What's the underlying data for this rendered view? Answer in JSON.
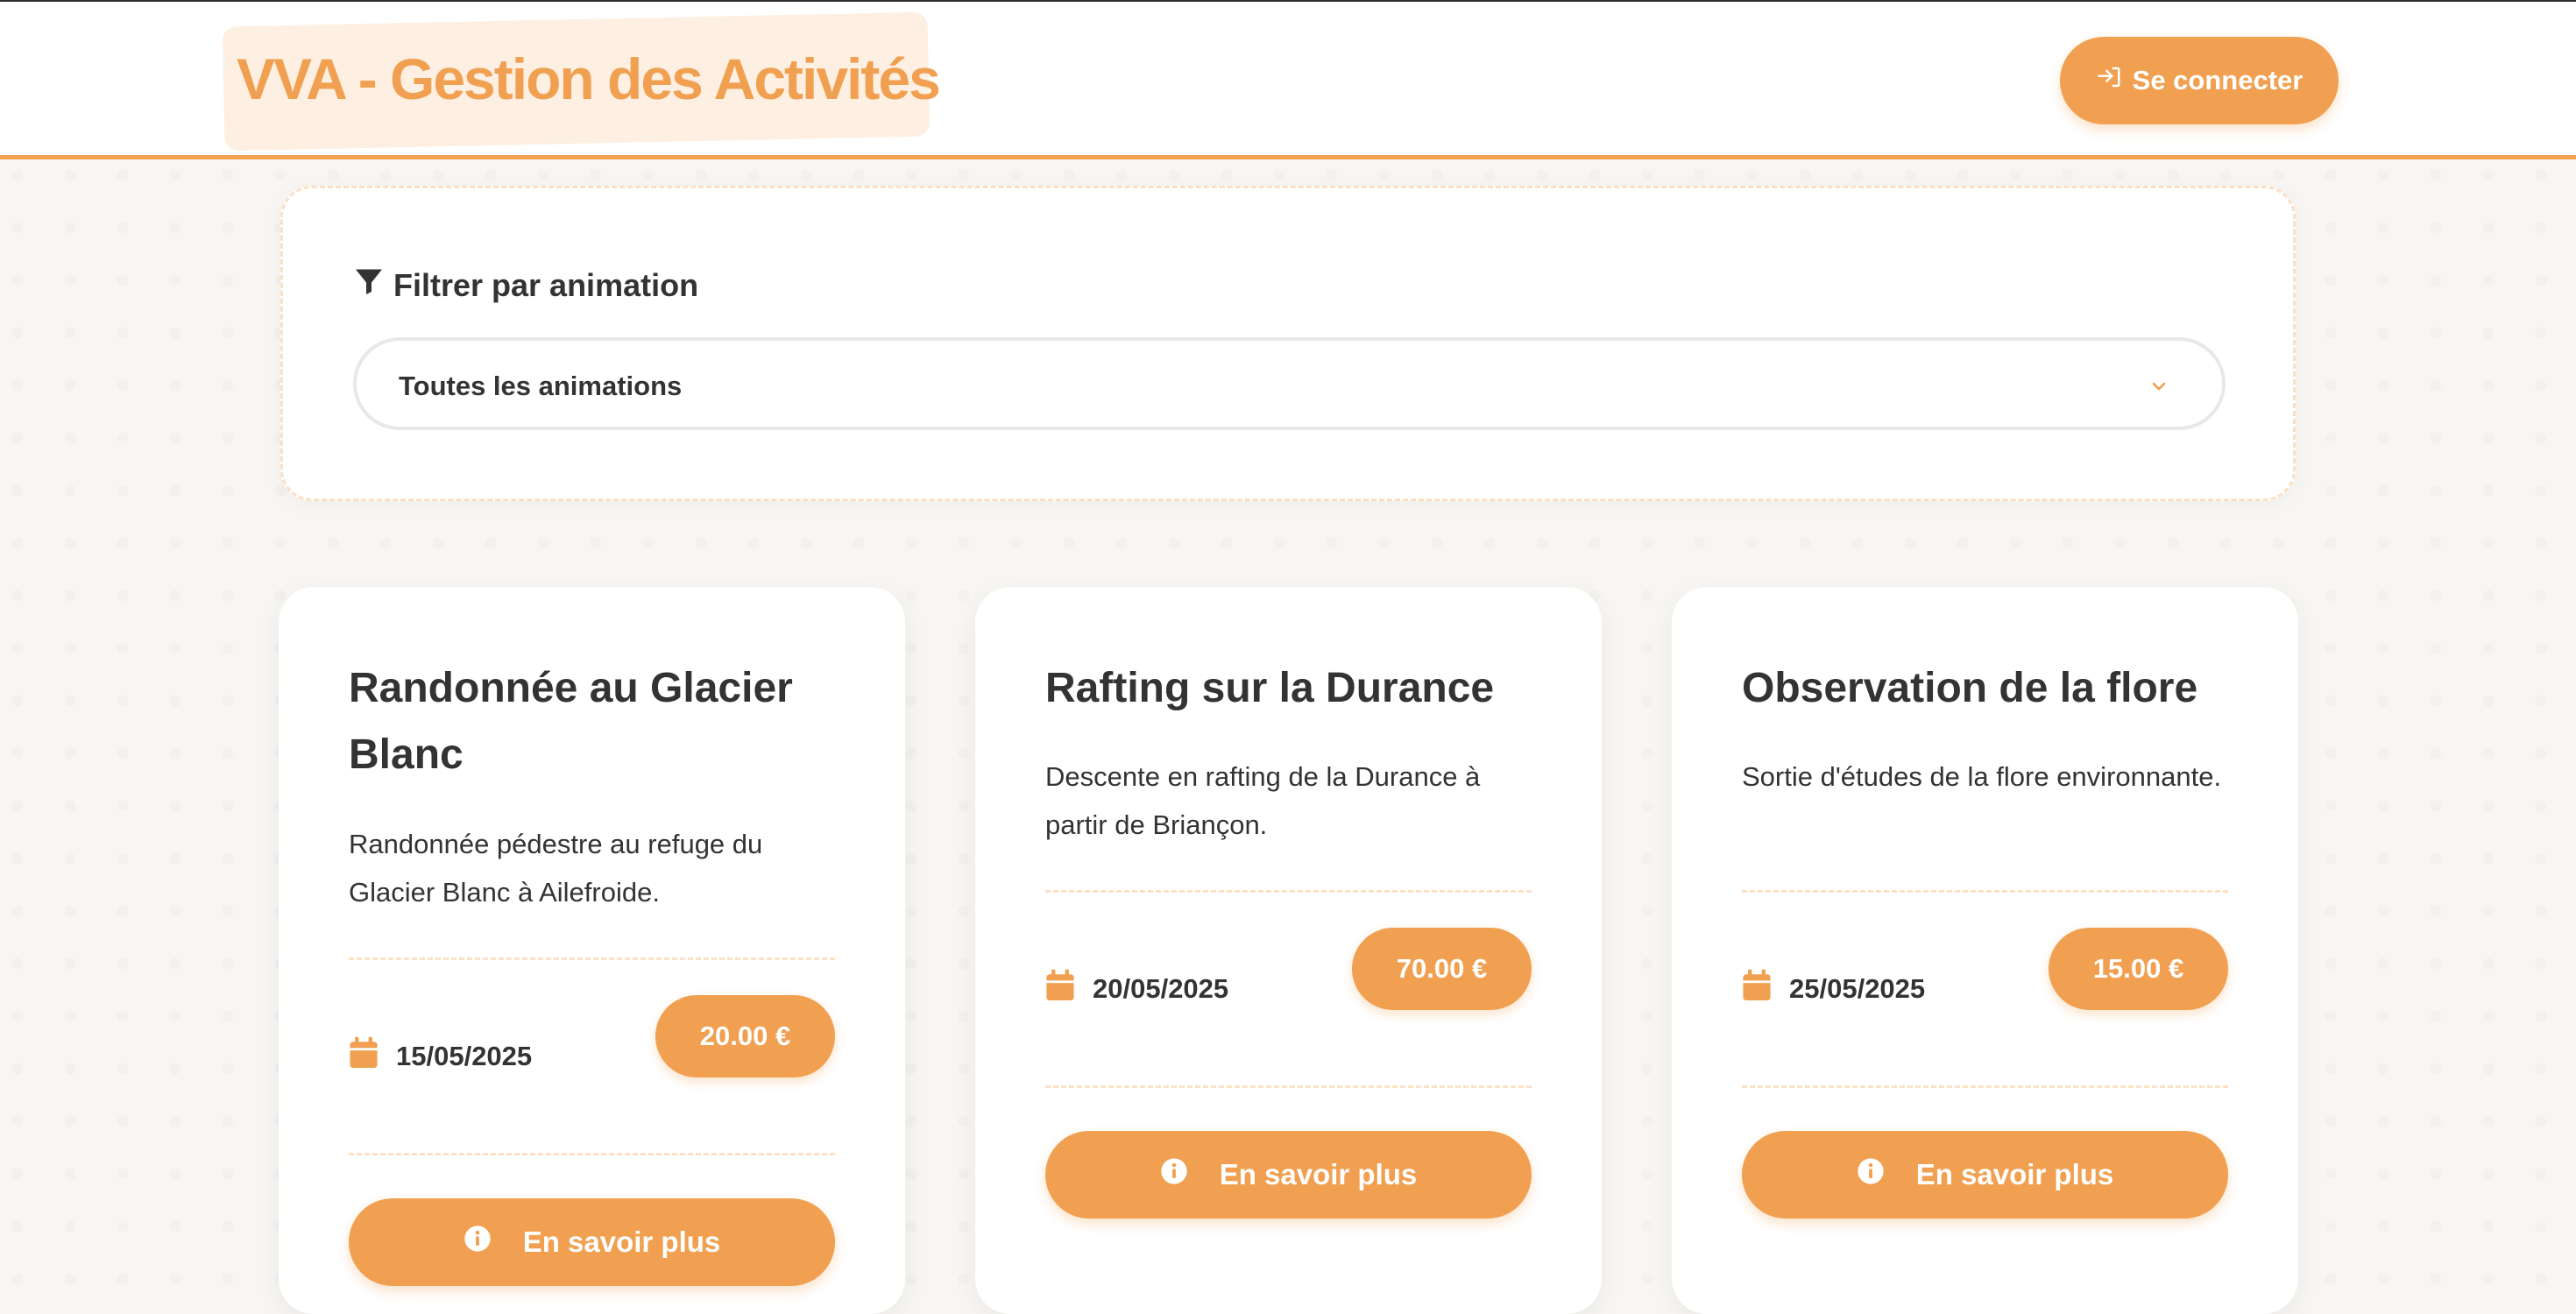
{
  "header": {
    "title": "VVA - Gestion des Activités",
    "login_label": "Se connecter"
  },
  "filter": {
    "label": "Filtrer par animation",
    "selected": "Toutes les animations"
  },
  "colors": {
    "accent": "#f0a050",
    "accent_light": "#fdf0e3",
    "text": "#333333"
  },
  "activities": [
    {
      "title": "Randonnée au Glacier Blanc",
      "description": "Randonnée pédestre au refuge du Glacier Blanc à Ailefroide.",
      "date": "15/05/2025",
      "price": "20.00 €",
      "more_label": "En savoir plus"
    },
    {
      "title": "Rafting sur la Durance",
      "description": "Descente en rafting de la Durance à partir de Briançon.",
      "date": "20/05/2025",
      "price": "70.00 €",
      "more_label": "En savoir plus"
    },
    {
      "title": "Observation de la flore",
      "description": "Sortie d'études de la flore environnante.",
      "date": "25/05/2025",
      "price": "15.00 €",
      "more_label": "En savoir plus"
    }
  ],
  "icons": {
    "login": "sign-in-icon",
    "filter": "funnel-icon",
    "dropdown": "chevron-down-icon",
    "date": "calendar-icon",
    "info": "info-circle-icon"
  }
}
